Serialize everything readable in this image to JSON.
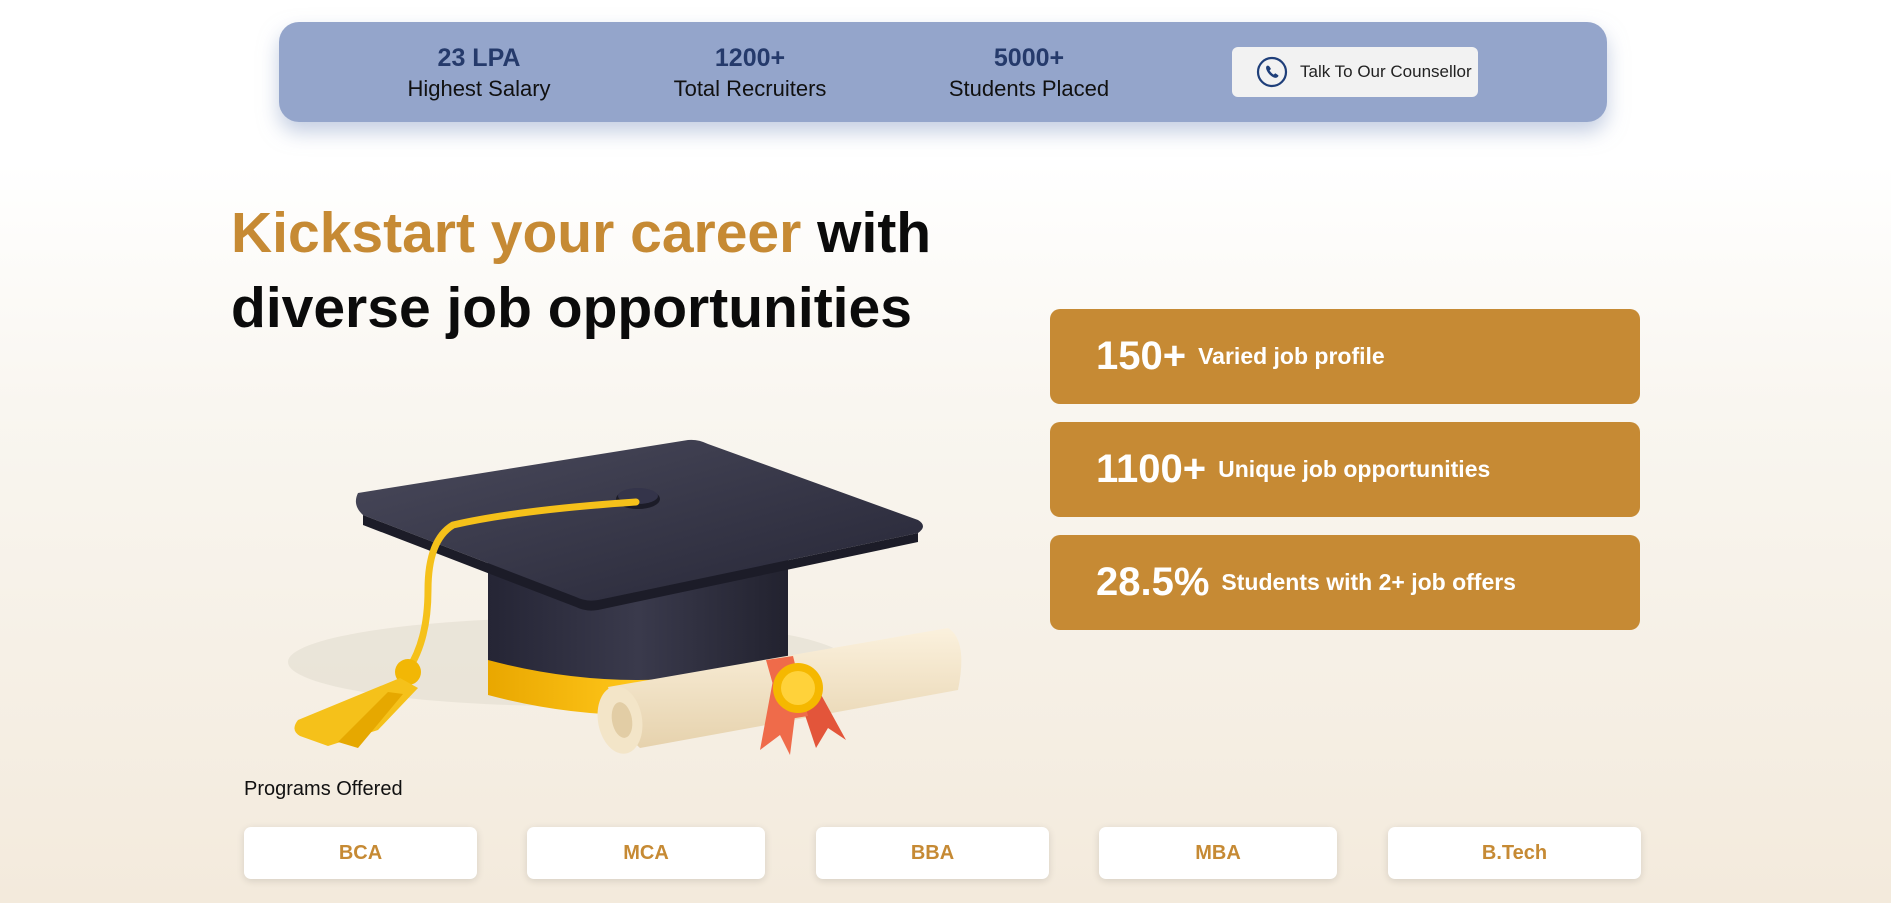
{
  "stats": [
    {
      "value": "23 LPA",
      "label": "Highest Salary"
    },
    {
      "value": "1200+",
      "label": "Total Recruiters"
    },
    {
      "value": "5000+",
      "label": "Students Placed"
    }
  ],
  "counsellor": {
    "label": "Talk To Our Counsellor",
    "icon": "phone-icon"
  },
  "headline": {
    "accent": "Kickstart your career",
    "rest_line1": " with",
    "rest_line2": "diverse job opportunities"
  },
  "highlights": [
    {
      "number": "150+",
      "text": "Varied job profile"
    },
    {
      "number": "1100+",
      "text": "Unique job opportunities"
    },
    {
      "number": "28.5%",
      "text": "Students with 2+ job offers"
    }
  ],
  "programs": {
    "title": "Programs Offered",
    "items": [
      "BCA",
      "MCA",
      "BBA",
      "MBA",
      "B.Tech"
    ]
  },
  "colors": {
    "accent": "#c68a34",
    "stats_bar": "#94a5cb",
    "stat_value": "#253a6b"
  },
  "illustration": "graduation-cap-and-diploma"
}
